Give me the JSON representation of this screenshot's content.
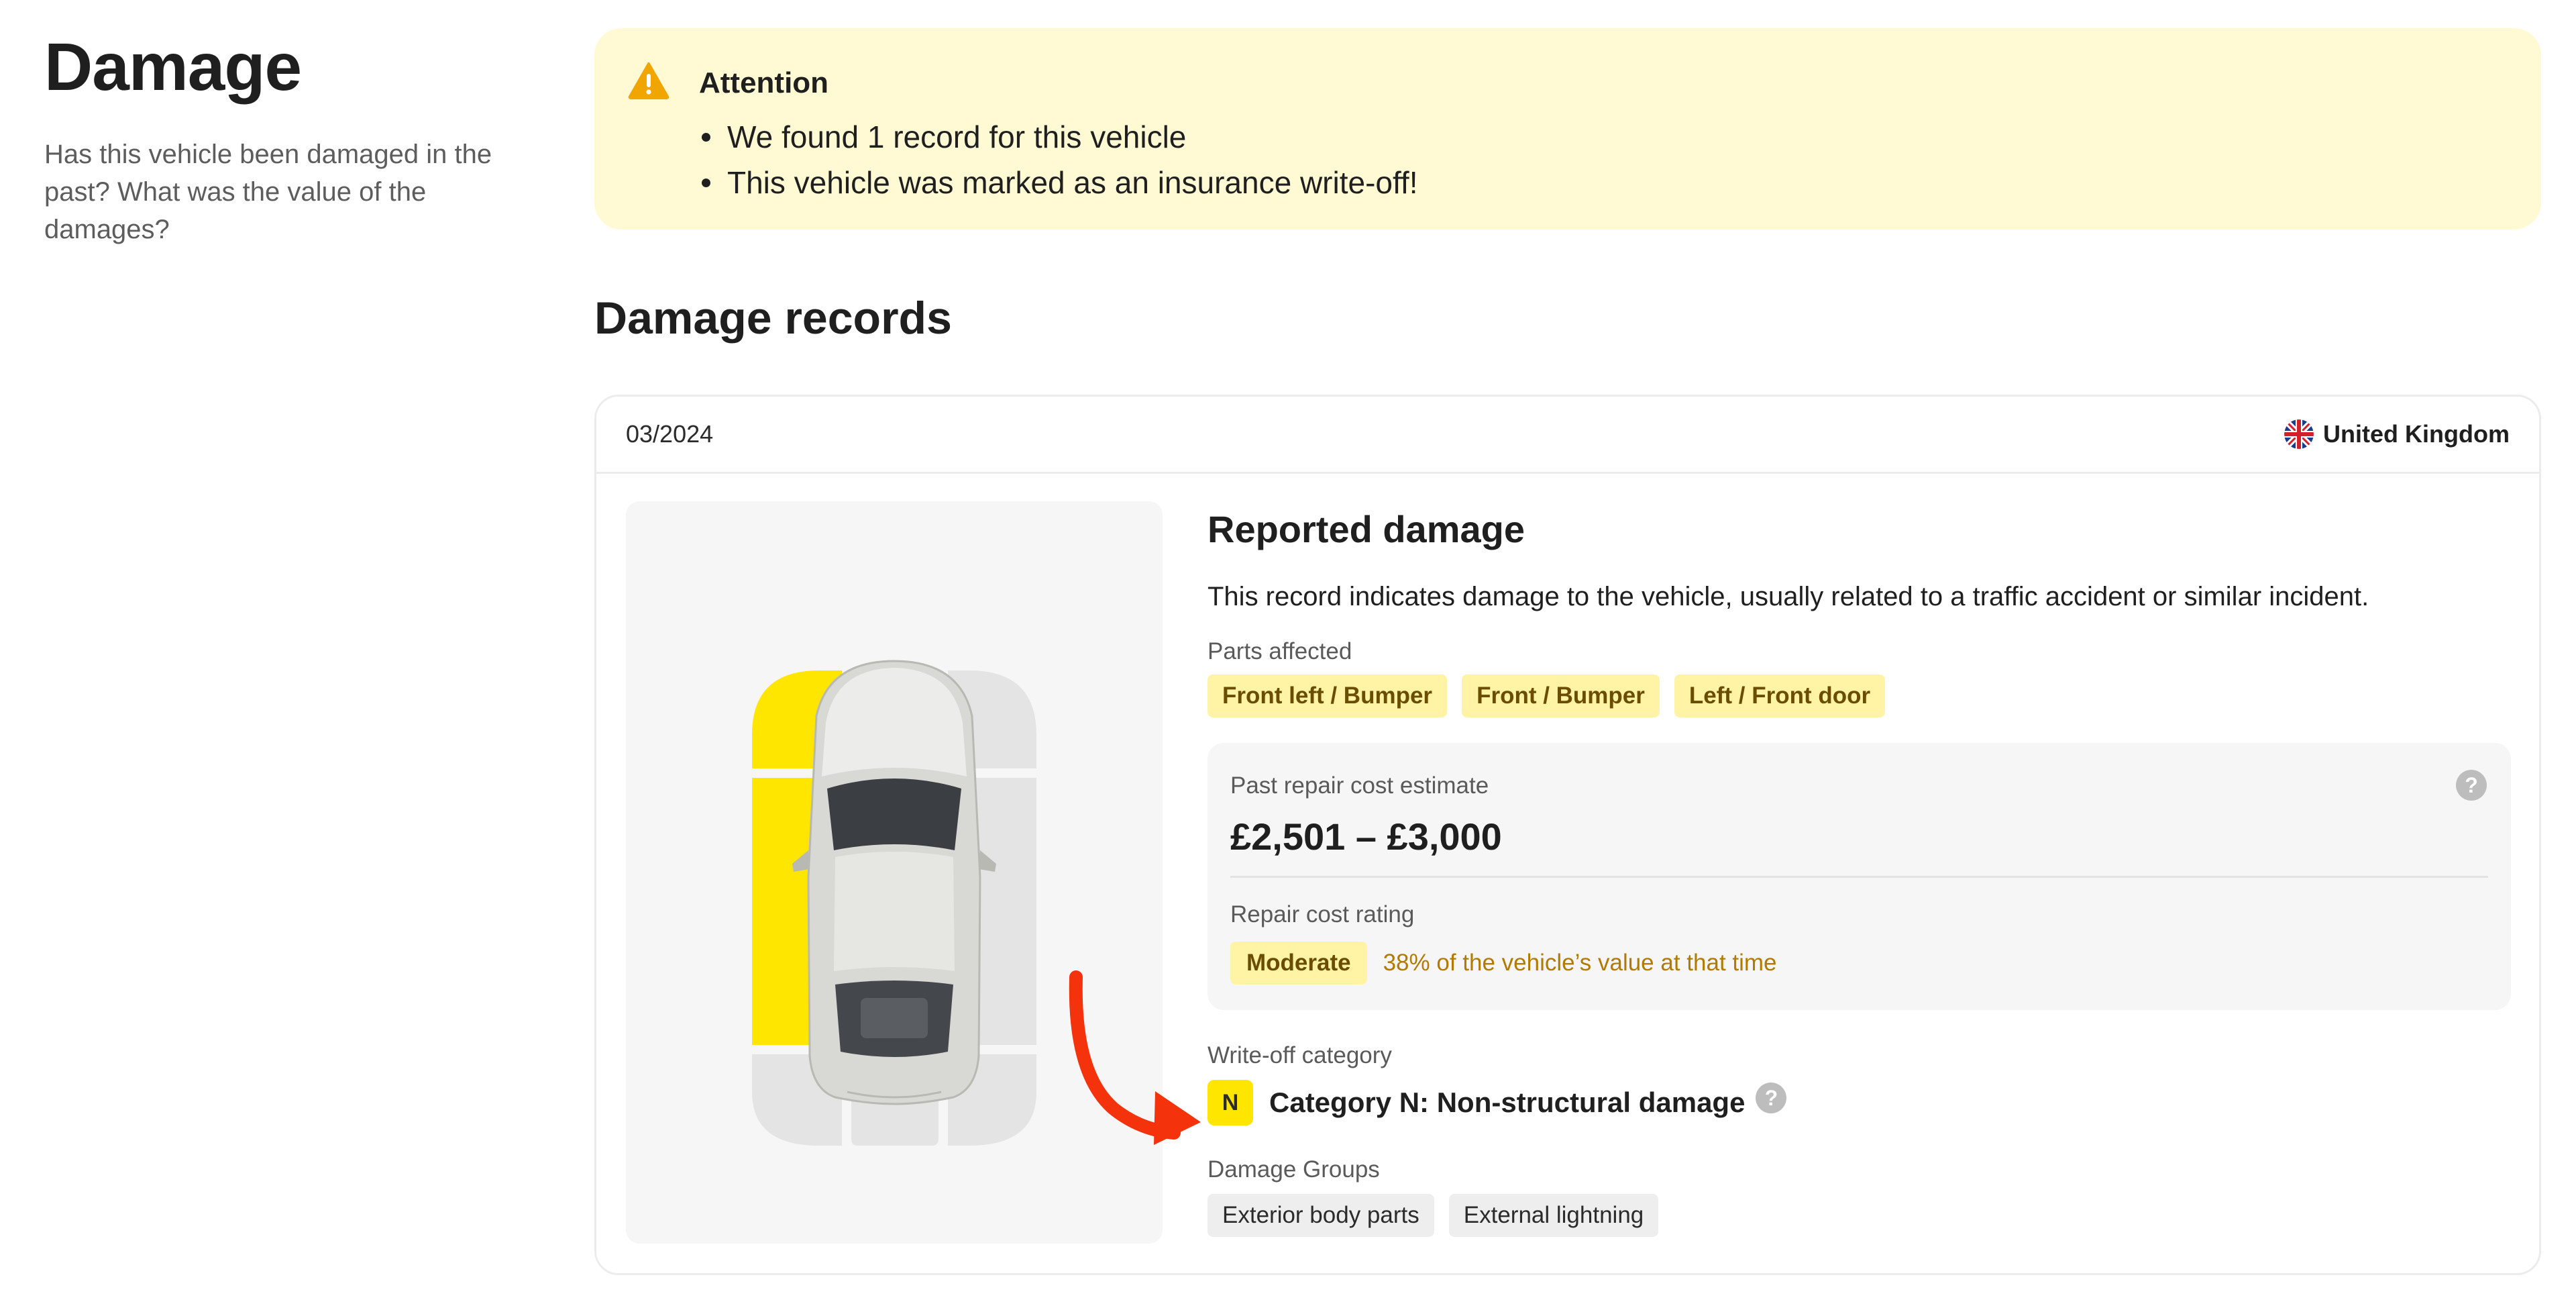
{
  "intro": {
    "title": "Damage",
    "description": "Has this vehicle been damaged in the past? What was the value of the damages?"
  },
  "alert": {
    "title": "Attention",
    "items": [
      "We found 1 record for this vehicle",
      "This vehicle was marked as an insurance write-off!"
    ],
    "icon": "warning-icon"
  },
  "records": {
    "title": "Damage records",
    "record": {
      "date": "03/2024",
      "country": "United Kingdom",
      "heading": "Reported damage",
      "description": "This record indicates damage to the vehicle, usually related to a traffic accident or similar incident.",
      "parts_label": "Parts affected",
      "parts": [
        "Front left / Bumper",
        "Front / Bumper",
        "Left / Front door"
      ],
      "cost_label": "Past repair cost estimate",
      "cost_value": "£2,501 – £3,000",
      "rating_label": "Repair cost rating",
      "rating_value": "Moderate",
      "rating_note": "38% of the vehicle’s value at that time",
      "writeoff_label": "Write-off category",
      "writeoff_code": "N",
      "writeoff_text": "Category N: Non-structural damage",
      "groups_label": "Damage Groups",
      "groups": [
        "Exterior body parts",
        "External lightning"
      ],
      "help_glyph": "?"
    }
  },
  "colors": {
    "alert_bg": "#fffad4",
    "damaged_zone": "#ffe600",
    "undamaged_zone": "#e4e4e4",
    "chip_bg": "#fff3a6",
    "arrow": "#f4320b",
    "warning": "#f0a500"
  }
}
